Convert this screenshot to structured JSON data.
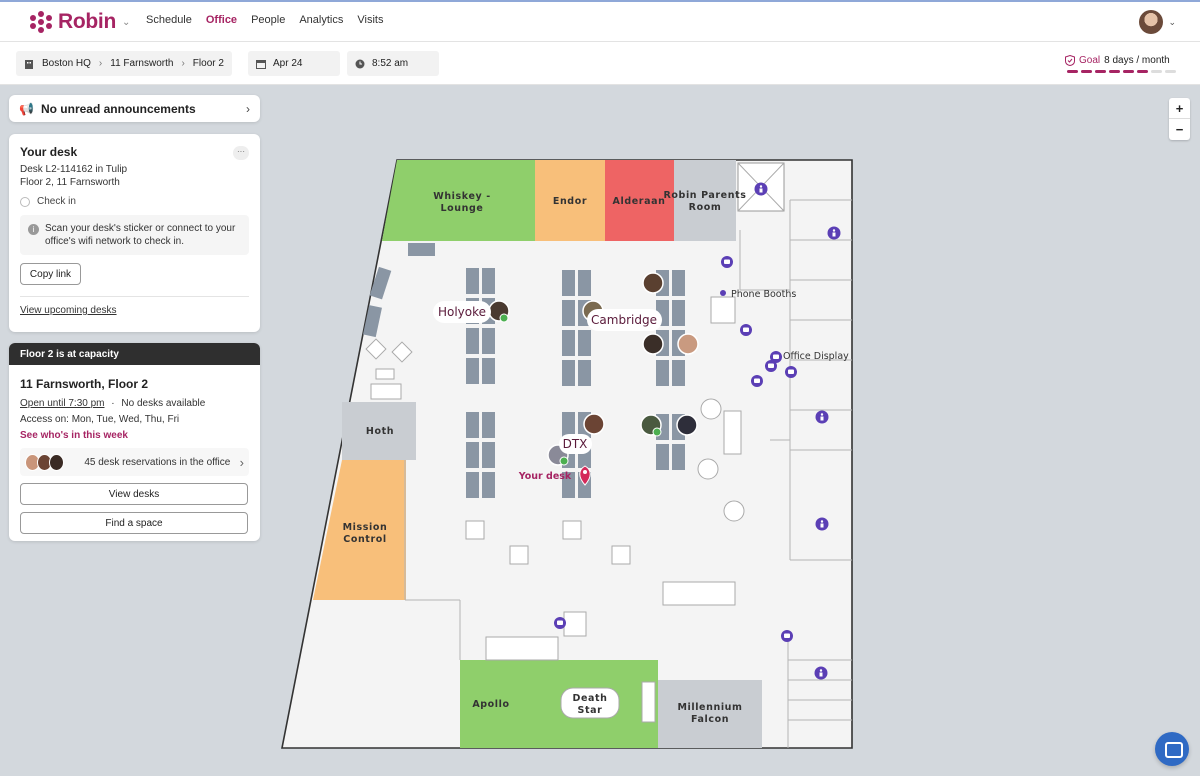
{
  "nav": {
    "brand": "Robin",
    "items": [
      {
        "label": "Schedule",
        "active": false
      },
      {
        "label": "Office",
        "active": true
      },
      {
        "label": "People",
        "active": false
      },
      {
        "label": "Analytics",
        "active": false
      },
      {
        "label": "Visits",
        "active": false
      }
    ]
  },
  "location": {
    "building": "Boston HQ",
    "address": "11 Farnsworth",
    "floor": "Floor 2",
    "date": "Apr 24",
    "time": "8:52 am"
  },
  "goal": {
    "label": "Goal",
    "value": "8 days / month",
    "filled": 6,
    "total": 8
  },
  "announcements": {
    "label": "No unread announcements"
  },
  "your_desk": {
    "title": "Your desk",
    "menu": "···",
    "desk_line": "Desk L2-114162 in Tulip",
    "location_line": "Floor 2, 11 Farnsworth",
    "check_in": "Check in",
    "info": "Scan your desk's sticker or connect to your office's wifi network to check in.",
    "copy_link": "Copy link",
    "view_upcoming": "View upcoming desks"
  },
  "capacity": {
    "banner": "Floor 2 is at capacity",
    "title": "11 Farnsworth, Floor 2",
    "open_until": "Open until 7:30 pm",
    "separator": "·",
    "availability": "No desks available",
    "access": "Access on: Mon, Tue, Wed, Thu, Fri",
    "see_who": "See who's in this week",
    "reservations": "45 desk reservations in the office",
    "view_desks": "View desks",
    "find_space": "Find a space"
  },
  "map": {
    "rooms": {
      "whiskey": [
        "Whiskey -",
        "Lounge"
      ],
      "endor": "Endor",
      "alderaan": "Alderaan",
      "robin_parents": [
        "Robin Parents",
        "Room"
      ],
      "phone_booths": "Phone Booths",
      "office_display": "Office Display",
      "hoth": "Hoth",
      "mission_control": [
        "Mission",
        "Control"
      ],
      "apollo": "Apollo",
      "death_star": [
        "Death",
        "Star"
      ],
      "millennium": [
        "Millennium",
        "Falcon"
      ]
    },
    "pins": {
      "holyoke": "Holyoke",
      "cambridge": "Cambridge",
      "dtx": "DTX",
      "your_desk": "Your desk"
    },
    "colors": {
      "green": "#8fcf6b",
      "orange": "#f8bf7a",
      "red": "#ee6464",
      "gray": "#c9cdd2",
      "accent": "#a62463",
      "amenity": "#5b3fb5"
    }
  },
  "zoom": {
    "in": "+",
    "out": "−"
  }
}
